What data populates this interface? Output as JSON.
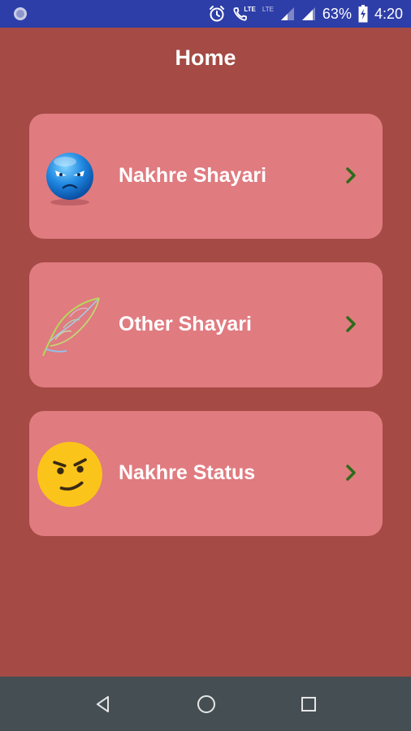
{
  "status_bar": {
    "battery_percent": "63%",
    "time": "4:20",
    "network_label": "LTE",
    "network_label_2": "LTE"
  },
  "page": {
    "title": "Home"
  },
  "menu": {
    "items": [
      {
        "label": "Nakhre Shayari",
        "icon": "angry-blue-face-icon"
      },
      {
        "label": "Other Shayari",
        "icon": "feather-quill-icon"
      },
      {
        "label": "Nakhre Status",
        "icon": "smirking-face-icon"
      }
    ]
  },
  "colors": {
    "background": "#a54a44",
    "card": "#e07b80",
    "status_bar": "#2d3ea8",
    "nav_bar": "#454f53",
    "chevron": "#2e6b1a"
  },
  "nav_bar": {
    "buttons": [
      "back-icon",
      "home-icon",
      "recents-icon"
    ]
  }
}
